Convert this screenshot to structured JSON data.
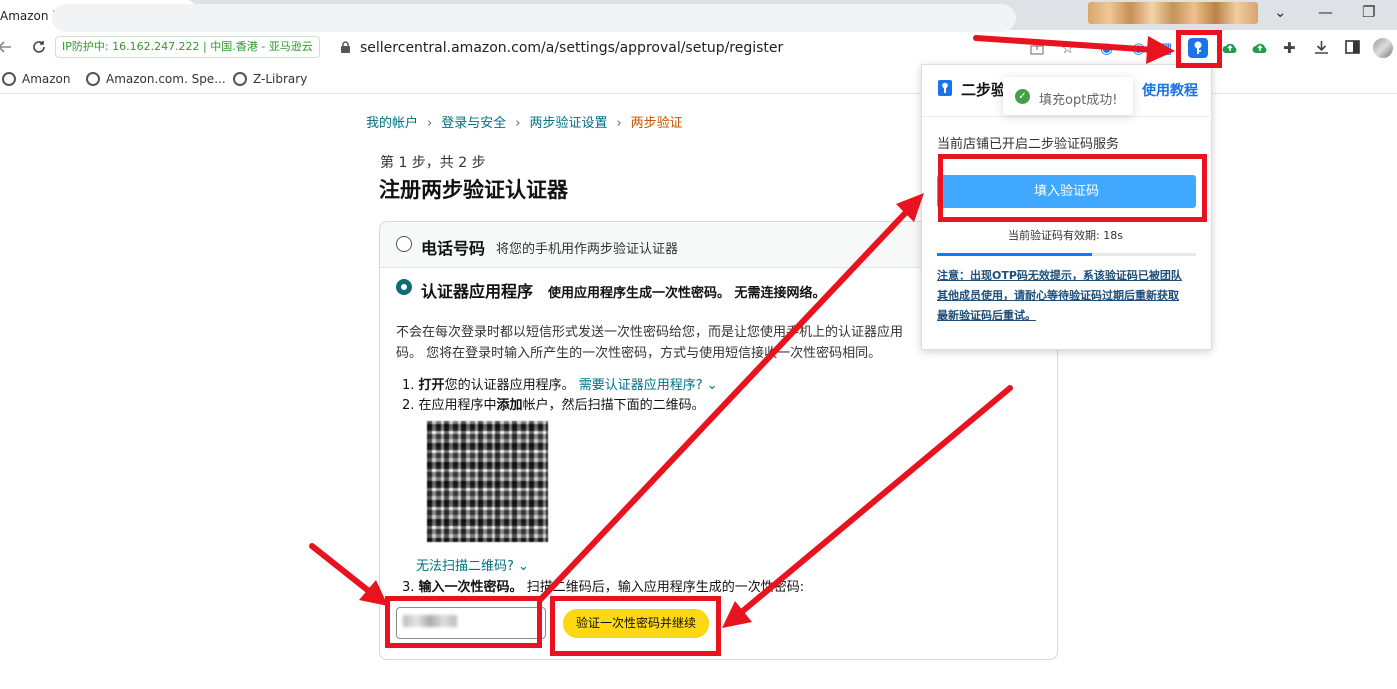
{
  "browser": {
    "tab_title": "Amazon 两步验证",
    "tab_close": "✕",
    "new_tab": "+",
    "ip_chip": "IP防护中: 16.162.247.222 | 中国.香港 - 亚马逊云",
    "url": "sellercentral.amazon.com/a/settings/approval/setup/register",
    "bookmarks": [
      "Amazon",
      "Amazon.com. Spe...",
      "Z-Library"
    ],
    "window_controls": [
      "⌄",
      "—",
      "❐"
    ],
    "icons": {
      "back": "back-arrow-icon",
      "reload": "reload-icon",
      "lock": "lock-icon",
      "share": "share-icon",
      "star": "bookmark-star-icon",
      "extension_key": "key-icon",
      "upload1": "cloud-upload-icon",
      "upload2": "cloud-upload-icon",
      "puzzle": "puzzle-icon",
      "download": "download-icon",
      "sidepanel": "side-panel-icon",
      "avatar": "avatar-icon"
    }
  },
  "page": {
    "breadcrumb": [
      "我的帐户",
      "登录与安全",
      "两步验证设置",
      "两步验证"
    ],
    "breadcrumb_sep": "›",
    "step": "第 1 步，共 2 步",
    "heading": "注册两步验证认证器",
    "option_phone": {
      "title": "电话号码",
      "desc": "将您的手机用作两步验证认证器"
    },
    "option_app": {
      "title": "认证器应用程序",
      "desc": "使用应用程序生成一次性密码。 无需连接网络。"
    },
    "para_line1": "不会在每次登录时都以短信形式发送一次性密码给您，而是让您使用手机上的认证器应用",
    "para_line2": "码。 您将在登录时输入所产生的一次性密码，方式与使用短信接收一次性密码相同。",
    "list": {
      "item1_prefix": "1. ",
      "item1_bold": "打开",
      "item1_rest": "您的认证器应用程序。 ",
      "item1_link": "需要认证器应用程序?",
      "item2_prefix": "2. 在应用程序中",
      "item2_bold": "添加",
      "item2_rest": "帐户，然后扫描下面的二维码。",
      "cant_scan": "无法扫描二维码?",
      "item3_prefix": "3. ",
      "item3_bold": "输入一次性密码。",
      "item3_rest": " 扫描二维码后，输入应用程序生成的一次性密码:"
    },
    "verify_button": "验证一次性密码并继续"
  },
  "popup": {
    "title": "二步验",
    "tutorial": "使用教程",
    "toast": "填充opt成功!",
    "status": "当前店铺已开启二步验证码服务",
    "fill_button": "填入验证码",
    "validity": "当前验证码有效期: 18s",
    "progress": 0.6,
    "notice_lines": [
      "注意：出现OTP码无效提示，系该验证码已被团队",
      "其他成员使用，请耐心等待验证码过期后重新获取",
      "最新验证码后重试。"
    ]
  },
  "colors": {
    "annotation_red": "#e8131f",
    "link": "#007185",
    "breadcrumb_current": "#c45500",
    "primary_button": "#40a9ff",
    "amazon_yellow": "#ffd814"
  }
}
